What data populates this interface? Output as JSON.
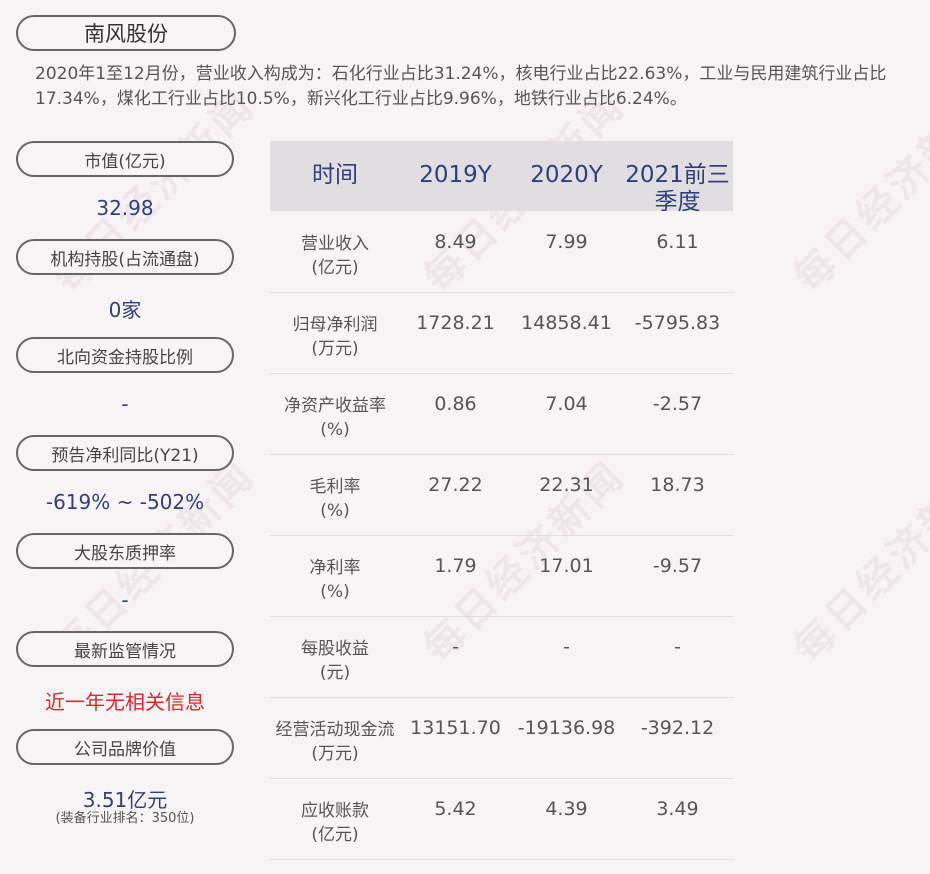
{
  "company": "南风股份",
  "summary": "2020年1至12月份，营业收入构成为：石化行业占比31.24%，核电行业占比22.63%，工业与民用建筑行业占比17.34%，煤化工行业占比10.5%，新兴化工行业占比9.96%，地铁行业占比6.24%。",
  "watermark": "每日经济新闻",
  "metrics": [
    {
      "label": "市值(亿元)",
      "value": "32.98"
    },
    {
      "label": "机构持股(占流通盘)",
      "value": "0家"
    },
    {
      "label": "北向资金持股比例",
      "value": "-"
    },
    {
      "label": "预告净利同比(Y21)",
      "value": "-619% ~ -502%"
    },
    {
      "label": "大股东质押率",
      "value": "-"
    },
    {
      "label": "最新监管情况",
      "value": "近一年无相关信息"
    },
    {
      "label": "公司品牌价值",
      "value": "3.51亿元",
      "sub": "(装备行业排名：350位)"
    }
  ],
  "table": {
    "headers": [
      "时间",
      "2019Y",
      "2020Y",
      "2021前三季度"
    ],
    "rows": [
      {
        "label": "营业收入",
        "unit": "(亿元)",
        "values": [
          "8.49",
          "7.99",
          "6.11"
        ]
      },
      {
        "label": "归母净利润",
        "unit": "(万元)",
        "values": [
          "1728.21",
          "14858.41",
          "-5795.83"
        ]
      },
      {
        "label": "净资产收益率",
        "unit": "(%)",
        "values": [
          "0.86",
          "7.04",
          "-2.57"
        ]
      },
      {
        "label": "毛利率",
        "unit": "(%)",
        "values": [
          "27.22",
          "22.31",
          "18.73"
        ]
      },
      {
        "label": "净利率",
        "unit": "(%)",
        "values": [
          "1.79",
          "17.01",
          "-9.57"
        ]
      },
      {
        "label": "每股收益",
        "unit": "(元)",
        "values": [
          "-",
          "-",
          "-"
        ]
      },
      {
        "label": "经营活动现金流",
        "unit": "(万元)",
        "values": [
          "13151.70",
          "-19136.98",
          "-392.12"
        ]
      },
      {
        "label": "应收账款",
        "unit": "(亿元)",
        "values": [
          "5.42",
          "4.39",
          "3.49"
        ]
      }
    ]
  }
}
